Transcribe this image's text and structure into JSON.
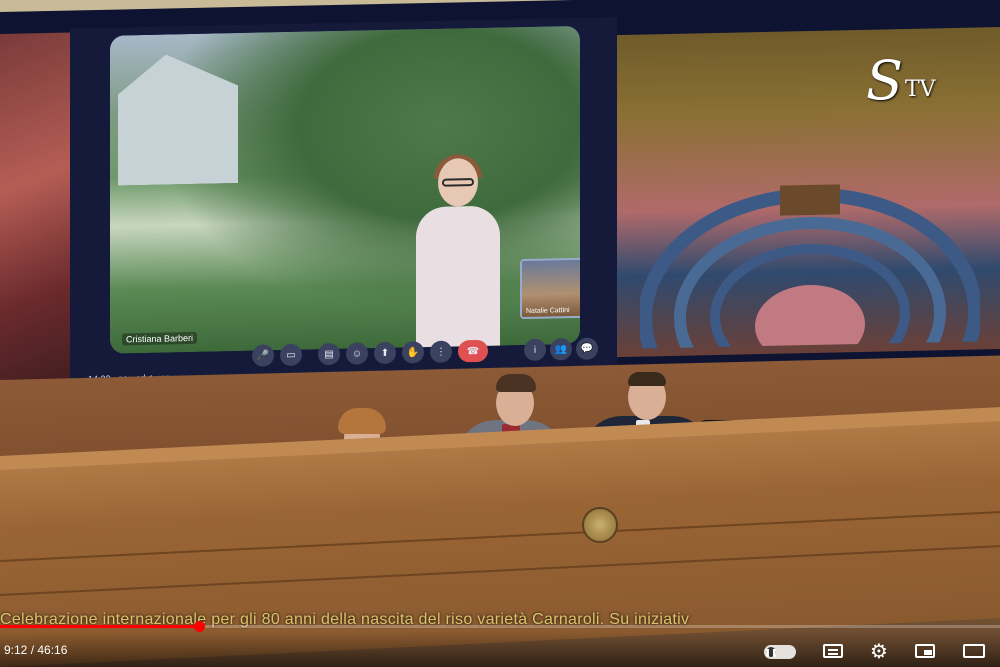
{
  "video": {
    "caption": "Celebrazione internazionale per gli 80 anni della nascita del riso varietà Carnaroli. Su iniziativ",
    "current_time": "9:12",
    "duration": "46:16",
    "time_display": "9:12 / 46:16",
    "progress": 0.199
  },
  "channel_logo": {
    "letter": "S",
    "suffix": "TV"
  },
  "call_screen": {
    "clock": "14:22",
    "meeting_code": "geu-cdvt-yen",
    "participant_name": "Cristiana Barberi",
    "pip_label": "Natalie Cattini",
    "toolbar_icons": [
      "mic-icon",
      "camera-icon",
      "captions-icon",
      "emoji-icon",
      "present-icon",
      "hand-icon",
      "more-icon",
      "end-call-icon"
    ]
  },
  "colors": {
    "progress": "#ff0000",
    "caption": "#d9c26a",
    "end_call": "#e05050"
  }
}
